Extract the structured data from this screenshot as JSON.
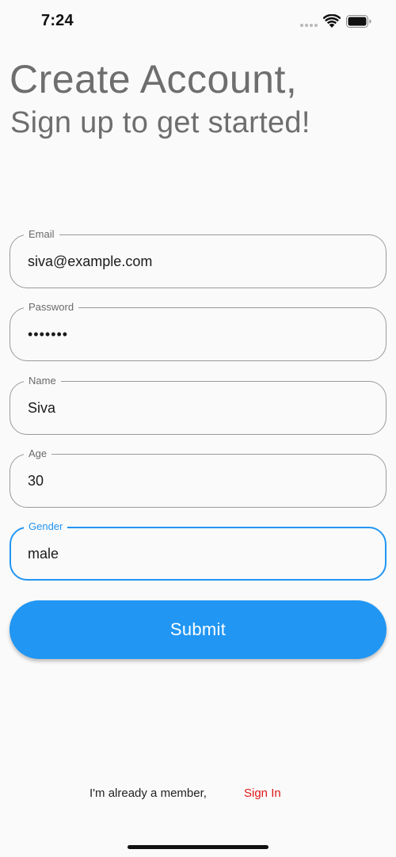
{
  "status_bar": {
    "time": "7:24"
  },
  "header": {
    "title": "Create Account,",
    "subtitle": "Sign up to get started!"
  },
  "form": {
    "fields": [
      {
        "label": "Email",
        "value": "siva@example.com",
        "focused": false
      },
      {
        "label": "Password",
        "value": "•••••••",
        "focused": false
      },
      {
        "label": "Name",
        "value": "Siva",
        "focused": false
      },
      {
        "label": "Age",
        "value": "30",
        "focused": false
      },
      {
        "label": "Gender",
        "value": "male",
        "focused": true
      }
    ],
    "submit_label": "Submit"
  },
  "footer": {
    "member_text": "I'm already a member,",
    "sign_in_label": "Sign In"
  },
  "colors": {
    "accent": "#2196f3",
    "link": "#e01818",
    "title_gray": "#6e6e6e",
    "background": "#fafafa"
  },
  "icons": [
    "wifi-icon",
    "battery-icon",
    "cellular-dots-icon"
  ]
}
